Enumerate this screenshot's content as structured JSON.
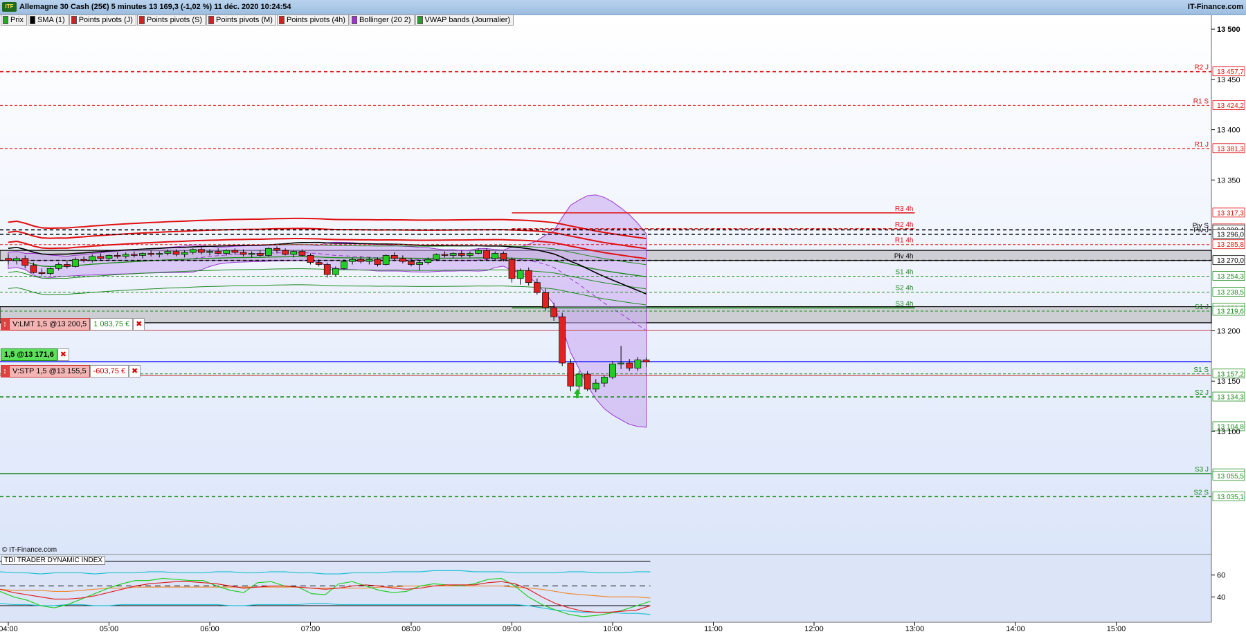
{
  "window": {
    "logo": "ITF",
    "title": "Allemagne 30 Cash (25€) 5 minutes 13 169,3 (-1,02 %) 11 déc. 2020 10:24:54",
    "brand": "IT-Finance.com"
  },
  "legend": [
    {
      "label": "Prix",
      "color": "#22aa22"
    },
    {
      "label": "SMA (1)",
      "color": "#000000"
    },
    {
      "label": "Points pivots (J)",
      "color": "#d02020"
    },
    {
      "label": "Points pivots (S)",
      "color": "#d02020"
    },
    {
      "label": "Points pivots (M)",
      "color": "#d02020"
    },
    {
      "label": "Points pivots (4h)",
      "color": "#d02020"
    },
    {
      "label": "Bollinger (20 2)",
      "color": "#9a35d0"
    },
    {
      "label": "VWAP bands (Journalier)",
      "color": "#2a9a2a"
    }
  ],
  "orders": [
    {
      "label": "V:LMT  1,5 @13 200,5",
      "pl": "1 083,75 €",
      "pl_color": "#1a8a1a",
      "close": "✖"
    },
    {
      "label": "1,5 @13 171,6",
      "close": "✖"
    },
    {
      "label": "V:STP  1,5 @13 155,5",
      "pl": "-603,75 €",
      "pl_color": "#cc0000",
      "close": "✖"
    }
  ],
  "copyright": "© IT-Finance.com",
  "tdi_label": "TDI TRADER DYNAMIC INDEX",
  "chart_data": {
    "type": "candlestick",
    "title": "Allemagne 30 Cash (25€) 5 minutes",
    "time_ticks": [
      "04:00",
      "05:00",
      "06:00",
      "07:00",
      "08:00",
      "09:00",
      "10:00",
      "11:00",
      "12:00",
      "13:00",
      "14:00",
      "15:00"
    ],
    "price_ticks": [
      "13 500",
      "13 450",
      "13 400",
      "13 350",
      "13 200",
      "13 150",
      "13 100"
    ],
    "ylim": [
      13000,
      13500
    ],
    "candles": [
      {
        "t": "04:00",
        "o": 13272,
        "h": 13276,
        "l": 13266,
        "c": 13270
      },
      {
        "t": "04:05",
        "o": 13270,
        "h": 13274,
        "l": 13266,
        "c": 13272
      },
      {
        "t": "04:10",
        "o": 13272,
        "h": 13275,
        "l": 13262,
        "c": 13265
      },
      {
        "t": "04:15",
        "o": 13265,
        "h": 13268,
        "l": 13257,
        "c": 13258
      },
      {
        "t": "04:20",
        "o": 13258,
        "h": 13262,
        "l": 13255,
        "c": 13257
      },
      {
        "t": "04:25",
        "o": 13257,
        "h": 13263,
        "l": 13255,
        "c": 13262
      },
      {
        "t": "04:30",
        "o": 13262,
        "h": 13268,
        "l": 13260,
        "c": 13266
      },
      {
        "t": "04:35",
        "o": 13266,
        "h": 13270,
        "l": 13262,
        "c": 13264
      },
      {
        "t": "04:40",
        "o": 13264,
        "h": 13273,
        "l": 13263,
        "c": 13271
      },
      {
        "t": "04:45",
        "o": 13271,
        "h": 13274,
        "l": 13268,
        "c": 13270
      },
      {
        "t": "04:50",
        "o": 13270,
        "h": 13276,
        "l": 13268,
        "c": 13274
      },
      {
        "t": "04:55",
        "o": 13274,
        "h": 13277,
        "l": 13270,
        "c": 13272
      },
      {
        "t": "05:00",
        "o": 13272,
        "h": 13276,
        "l": 13270,
        "c": 13275
      },
      {
        "t": "05:05",
        "o": 13275,
        "h": 13278,
        "l": 13272,
        "c": 13274
      },
      {
        "t": "05:10",
        "o": 13274,
        "h": 13278,
        "l": 13272,
        "c": 13276
      },
      {
        "t": "05:15",
        "o": 13276,
        "h": 13279,
        "l": 13273,
        "c": 13275
      },
      {
        "t": "05:20",
        "o": 13275,
        "h": 13278,
        "l": 13272,
        "c": 13277
      },
      {
        "t": "05:25",
        "o": 13277,
        "h": 13280,
        "l": 13274,
        "c": 13276
      },
      {
        "t": "05:30",
        "o": 13276,
        "h": 13279,
        "l": 13273,
        "c": 13277
      },
      {
        "t": "05:35",
        "o": 13277,
        "h": 13281,
        "l": 13275,
        "c": 13279
      },
      {
        "t": "05:40",
        "o": 13279,
        "h": 13281,
        "l": 13274,
        "c": 13276
      },
      {
        "t": "05:45",
        "o": 13276,
        "h": 13280,
        "l": 13273,
        "c": 13278
      },
      {
        "t": "05:50",
        "o": 13278,
        "h": 13282,
        "l": 13276,
        "c": 13281
      },
      {
        "t": "05:55",
        "o": 13281,
        "h": 13283,
        "l": 13276,
        "c": 13278
      },
      {
        "t": "06:00",
        "o": 13278,
        "h": 13281,
        "l": 13275,
        "c": 13279
      },
      {
        "t": "06:05",
        "o": 13279,
        "h": 13282,
        "l": 13276,
        "c": 13277
      },
      {
        "t": "06:10",
        "o": 13277,
        "h": 13281,
        "l": 13275,
        "c": 13280
      },
      {
        "t": "06:15",
        "o": 13280,
        "h": 13282,
        "l": 13276,
        "c": 13278
      },
      {
        "t": "06:20",
        "o": 13278,
        "h": 13281,
        "l": 13274,
        "c": 13276
      },
      {
        "t": "06:25",
        "o": 13276,
        "h": 13279,
        "l": 13273,
        "c": 13277
      },
      {
        "t": "06:30",
        "o": 13277,
        "h": 13280,
        "l": 13274,
        "c": 13275
      },
      {
        "t": "06:35",
        "o": 13275,
        "h": 13283,
        "l": 13274,
        "c": 13282
      },
      {
        "t": "06:40",
        "o": 13282,
        "h": 13284,
        "l": 13277,
        "c": 13280
      },
      {
        "t": "06:45",
        "o": 13280,
        "h": 13282,
        "l": 13275,
        "c": 13276
      },
      {
        "t": "06:50",
        "o": 13276,
        "h": 13280,
        "l": 13273,
        "c": 13279
      },
      {
        "t": "06:55",
        "o": 13279,
        "h": 13281,
        "l": 13274,
        "c": 13275
      },
      {
        "t": "07:00",
        "o": 13275,
        "h": 13277,
        "l": 13266,
        "c": 13268
      },
      {
        "t": "07:05",
        "o": 13268,
        "h": 13271,
        "l": 13264,
        "c": 13266
      },
      {
        "t": "07:10",
        "o": 13266,
        "h": 13268,
        "l": 13253,
        "c": 13256
      },
      {
        "t": "07:15",
        "o": 13256,
        "h": 13264,
        "l": 13254,
        "c": 13262
      },
      {
        "t": "07:20",
        "o": 13262,
        "h": 13271,
        "l": 13261,
        "c": 13269
      },
      {
        "t": "07:25",
        "o": 13269,
        "h": 13273,
        "l": 13266,
        "c": 13271
      },
      {
        "t": "07:30",
        "o": 13271,
        "h": 13274,
        "l": 13267,
        "c": 13269
      },
      {
        "t": "07:35",
        "o": 13269,
        "h": 13273,
        "l": 13266,
        "c": 13271
      },
      {
        "t": "07:40",
        "o": 13271,
        "h": 13273,
        "l": 13264,
        "c": 13266
      },
      {
        "t": "07:45",
        "o": 13266,
        "h": 13276,
        "l": 13265,
        "c": 13275
      },
      {
        "t": "07:50",
        "o": 13275,
        "h": 13278,
        "l": 13270,
        "c": 13272
      },
      {
        "t": "07:55",
        "o": 13272,
        "h": 13275,
        "l": 13267,
        "c": 13269
      },
      {
        "t": "08:00",
        "o": 13269,
        "h": 13272,
        "l": 13264,
        "c": 13266
      },
      {
        "t": "08:05",
        "o": 13266,
        "h": 13270,
        "l": 13260,
        "c": 13268
      },
      {
        "t": "08:10",
        "o": 13268,
        "h": 13273,
        "l": 13266,
        "c": 13271
      },
      {
        "t": "08:15",
        "o": 13271,
        "h": 13277,
        "l": 13270,
        "c": 13276
      },
      {
        "t": "08:20",
        "o": 13276,
        "h": 13279,
        "l": 13273,
        "c": 13275
      },
      {
        "t": "08:25",
        "o": 13275,
        "h": 13278,
        "l": 13272,
        "c": 13277
      },
      {
        "t": "08:30",
        "o": 13277,
        "h": 13280,
        "l": 13273,
        "c": 13275
      },
      {
        "t": "08:35",
        "o": 13275,
        "h": 13279,
        "l": 13273,
        "c": 13277
      },
      {
        "t": "08:40",
        "o": 13277,
        "h": 13282,
        "l": 13276,
        "c": 13280
      },
      {
        "t": "08:45",
        "o": 13280,
        "h": 13282,
        "l": 13270,
        "c": 13272
      },
      {
        "t": "08:50",
        "o": 13272,
        "h": 13279,
        "l": 13270,
        "c": 13277
      },
      {
        "t": "08:55",
        "o": 13277,
        "h": 13279,
        "l": 13269,
        "c": 13271
      },
      {
        "t": "09:00",
        "o": 13271,
        "h": 13273,
        "l": 13248,
        "c": 13252
      },
      {
        "t": "09:05",
        "o": 13252,
        "h": 13262,
        "l": 13246,
        "c": 13260
      },
      {
        "t": "09:10",
        "o": 13260,
        "h": 13263,
        "l": 13245,
        "c": 13248
      },
      {
        "t": "09:15",
        "o": 13248,
        "h": 13252,
        "l": 13236,
        "c": 13238
      },
      {
        "t": "09:20",
        "o": 13238,
        "h": 13242,
        "l": 13220,
        "c": 13223
      },
      {
        "t": "09:25",
        "o": 13223,
        "h": 13228,
        "l": 13210,
        "c": 13214
      },
      {
        "t": "09:30",
        "o": 13214,
        "h": 13218,
        "l": 13165,
        "c": 13168
      },
      {
        "t": "09:35",
        "o": 13168,
        "h": 13172,
        "l": 13140,
        "c": 13145
      },
      {
        "t": "09:40",
        "o": 13145,
        "h": 13160,
        "l": 13138,
        "c": 13157
      },
      {
        "t": "09:45",
        "o": 13157,
        "h": 13160,
        "l": 13140,
        "c": 13142
      },
      {
        "t": "09:50",
        "o": 13142,
        "h": 13152,
        "l": 13139,
        "c": 13148
      },
      {
        "t": "09:55",
        "o": 13148,
        "h": 13156,
        "l": 13144,
        "c": 13154
      },
      {
        "t": "10:00",
        "o": 13154,
        "h": 13170,
        "l": 13152,
        "c": 13167
      },
      {
        "t": "10:05",
        "o": 13167,
        "h": 13185,
        "l": 13162,
        "c": 13168
      },
      {
        "t": "10:10",
        "o": 13168,
        "h": 13172,
        "l": 13160,
        "c": 13163
      },
      {
        "t": "10:15",
        "o": 13163,
        "h": 13174,
        "l": 13160,
        "c": 13171
      },
      {
        "t": "10:20",
        "o": 13171,
        "h": 13174,
        "l": 13164,
        "c": 13169
      }
    ],
    "levels": [
      {
        "label": "R2 J",
        "value": 13457.7,
        "tag": "13 457,7",
        "color": "#e01010",
        "style": "dash2"
      },
      {
        "label": "R1 S",
        "value": 13424.2,
        "tag": "13 424,2",
        "color": "#e01010",
        "style": "dash1"
      },
      {
        "label": "R1 J",
        "value": 13381.3,
        "tag": "13 381,3",
        "color": "#e01010",
        "style": "dash1"
      },
      {
        "label": "R3 4h",
        "value": 13317.3,
        "tag": "13 317,3",
        "color": "#e01010",
        "style": "solid4h"
      },
      {
        "label": "R2 4h",
        "value": 13301.5,
        "tag": "13 301,5",
        "color": "#e01010",
        "style": "dash4h"
      },
      {
        "label": "Piv S",
        "value": 13300.4,
        "tag": "13 300,4",
        "color": "#000000",
        "style": "dash2"
      },
      {
        "label": "Piv J",
        "value": 13296.0,
        "tag": "13 296,0",
        "color": "#000000",
        "style": "dash2"
      },
      {
        "label": "R1 4h",
        "value": 13285.8,
        "tag": "13 285,8",
        "color": "#e01010",
        "style": "dash1"
      },
      {
        "label": "Piv 4h",
        "value": 13270.0,
        "tag": "13 270,0",
        "color": "#000000",
        "style": "dash2"
      },
      {
        "label": "S1 4h",
        "value": 13254.3,
        "tag": "13 254,3",
        "color": "#1a8a1a",
        "style": "dash1"
      },
      {
        "label": "S2 4h",
        "value": 13238.5,
        "tag": "13 238,5",
        "color": "#1a8a1a",
        "style": "dash1"
      },
      {
        "label": "S3 4h",
        "value": 13222.8,
        "tag": "13 222,8",
        "color": "#1a8a1a",
        "style": "solid4h"
      },
      {
        "label": "S1 J",
        "value": 13219.6,
        "tag": "13 219,6",
        "color": "#1a8a1a",
        "style": "dash1"
      },
      {
        "label": "S1 S",
        "value": 13157.2,
        "tag": "13 157,2",
        "color": "#1a8a1a",
        "style": "dash1"
      },
      {
        "label": "S2 J",
        "value": 13134.3,
        "tag": "13 134,3",
        "color": "#1a8a1a",
        "style": "dash2"
      },
      {
        "label": "",
        "value": 13104.8,
        "tag": "13 104,8",
        "color": "#1a8a1a",
        "style": "none"
      },
      {
        "label": "S3 J",
        "value": 13057.9,
        "tag": "13 057,9",
        "color": "#1a8a1a",
        "style": "solid"
      },
      {
        "label": "",
        "value": 13055.5,
        "tag": "13 055,5",
        "color": "#1a8a1a",
        "style": "none"
      },
      {
        "label": "S2 S",
        "value": 13035.1,
        "tag": "13 035,1",
        "color": "#1a8a1a",
        "style": "dash2"
      }
    ],
    "zones": [
      {
        "from": 13270,
        "to": 13280
      },
      {
        "from": 13208,
        "to": 13224
      }
    ],
    "order_lines": [
      {
        "value": 13200.5,
        "color": "#c83a3a"
      },
      {
        "value": 13169.3,
        "color": "#0000ff"
      },
      {
        "value": 13155.5,
        "color": "#c83a3a"
      }
    ],
    "tdi": {
      "y_ticks": [
        "60",
        "40"
      ],
      "ylim": [
        20,
        75
      ],
      "levels": [
        50,
        32
      ],
      "series": [
        {
          "color": "#20c0d0",
          "values": [
            63,
            62,
            62,
            61,
            62,
            62,
            62,
            61,
            62,
            62,
            62,
            63,
            63,
            62,
            62,
            62,
            63,
            63,
            62,
            62,
            63,
            63,
            62,
            62,
            61,
            61,
            62,
            62,
            62,
            63,
            63,
            63,
            64,
            64,
            64,
            63,
            63,
            63,
            62,
            62,
            62,
            62,
            63,
            63,
            62,
            62,
            62,
            63,
            63
          ]
        },
        {
          "color": "#20c0d0",
          "values": [
            34,
            33,
            33,
            32,
            32,
            33,
            33,
            32,
            32,
            33,
            33,
            33,
            33,
            33,
            33,
            33,
            33,
            32,
            32,
            33,
            33,
            33,
            33,
            34,
            34,
            33,
            33,
            33,
            33,
            33,
            33,
            33,
            33,
            33,
            33,
            33,
            33,
            33,
            33,
            32,
            30,
            28,
            27,
            26,
            26,
            26,
            25,
            25,
            24
          ]
        },
        {
          "color": "#f08a30",
          "values": [
            47,
            46,
            46,
            46,
            45,
            45,
            46,
            47,
            48,
            48,
            49,
            49,
            49,
            49,
            49,
            49,
            49,
            49,
            49,
            49,
            49,
            49,
            49,
            48,
            48,
            48,
            48,
            48,
            49,
            49,
            50,
            50,
            50,
            50,
            50,
            50,
            50,
            50,
            49,
            48,
            47,
            45,
            43,
            42,
            41,
            40,
            40,
            40,
            39
          ]
        },
        {
          "color": "#22d022",
          "values": [
            45,
            40,
            37,
            32,
            30,
            33,
            38,
            43,
            48,
            52,
            55,
            55,
            57,
            56,
            55,
            55,
            50,
            46,
            44,
            53,
            54,
            50,
            49,
            43,
            42,
            52,
            54,
            50,
            46,
            44,
            45,
            50,
            52,
            51,
            50,
            52,
            56,
            57,
            50,
            40,
            33,
            28,
            24,
            22,
            23,
            25,
            28,
            32,
            36
          ]
        },
        {
          "color": "#e02020",
          "values": [
            47,
            44,
            42,
            40,
            38,
            38,
            39,
            41,
            44,
            47,
            50,
            52,
            53,
            54,
            54,
            53,
            52,
            50,
            48,
            49,
            50,
            50,
            49,
            48,
            47,
            48,
            50,
            51,
            50,
            48,
            47,
            48,
            50,
            51,
            51,
            51,
            53,
            54,
            52,
            47,
            40,
            34,
            30,
            27,
            26,
            26,
            27,
            28,
            32
          ]
        }
      ]
    }
  }
}
